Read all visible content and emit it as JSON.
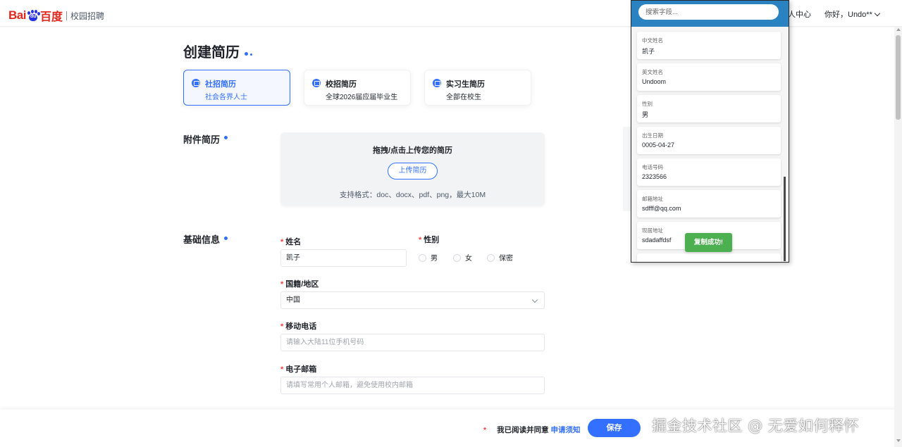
{
  "header": {
    "logo_text_bai": "Bai",
    "logo_text_paw": "du",
    "logo_text_du": "百度",
    "subtitle": "校园招聘",
    "personal_center": "人中心",
    "greeting": "你好，Undo**"
  },
  "page": {
    "title": "创建简历"
  },
  "resume_types": [
    {
      "title": "社招简历",
      "subtitle": "社会各界人士",
      "active": true
    },
    {
      "title": "校招简历",
      "subtitle": "全球2026届应届毕业生",
      "active": false
    },
    {
      "title": "实习生简历",
      "subtitle": "全部在校生",
      "active": false
    }
  ],
  "attachment": {
    "section_label": "附件简历",
    "heading": "拖拽/点击上传您的简历",
    "upload_button": "上传简历",
    "formats": "支持格式：doc、docx、pdf、png，最大10M"
  },
  "basic_info": {
    "section_label": "基础信息",
    "name_label": "姓名",
    "name_value": "凯子",
    "gender_label": "性别",
    "gender_options": [
      "男",
      "女",
      "保密"
    ],
    "region_label": "国籍/地区",
    "region_value": "中国",
    "phone_label": "移动电话",
    "phone_placeholder": "请输入大陆11位手机号码",
    "email_label": "电子邮箱",
    "email_placeholder": "请填写常用个人邮箱，避免使用校内邮箱",
    "req_mark": "*"
  },
  "footer": {
    "agree_text": "我已阅读并同意",
    "agree_link": "申请须知",
    "save_button": "保存",
    "req_mark": "*"
  },
  "watermark": "掘金技术社区 @ 无爱如何释怀",
  "panel": {
    "search_placeholder": "搜索字段...",
    "fields": [
      {
        "key": "中文姓名",
        "value": "凯子"
      },
      {
        "key": "英文姓名",
        "value": "Undoom"
      },
      {
        "key": "性别",
        "value": "男"
      },
      {
        "key": "出生日期",
        "value": "0005-04-27"
      },
      {
        "key": "电话号码",
        "value": "2323566"
      },
      {
        "key": "邮箱地址",
        "value": "sdfff@qq.com"
      },
      {
        "key": "现居地址",
        "value": "sdadaffdsf"
      }
    ],
    "toast": "复制成功!"
  },
  "colors": {
    "primary": "#3370ff",
    "panel_header": "#2a83c0",
    "toast": "#4caf50",
    "required": "#f53f3f"
  }
}
